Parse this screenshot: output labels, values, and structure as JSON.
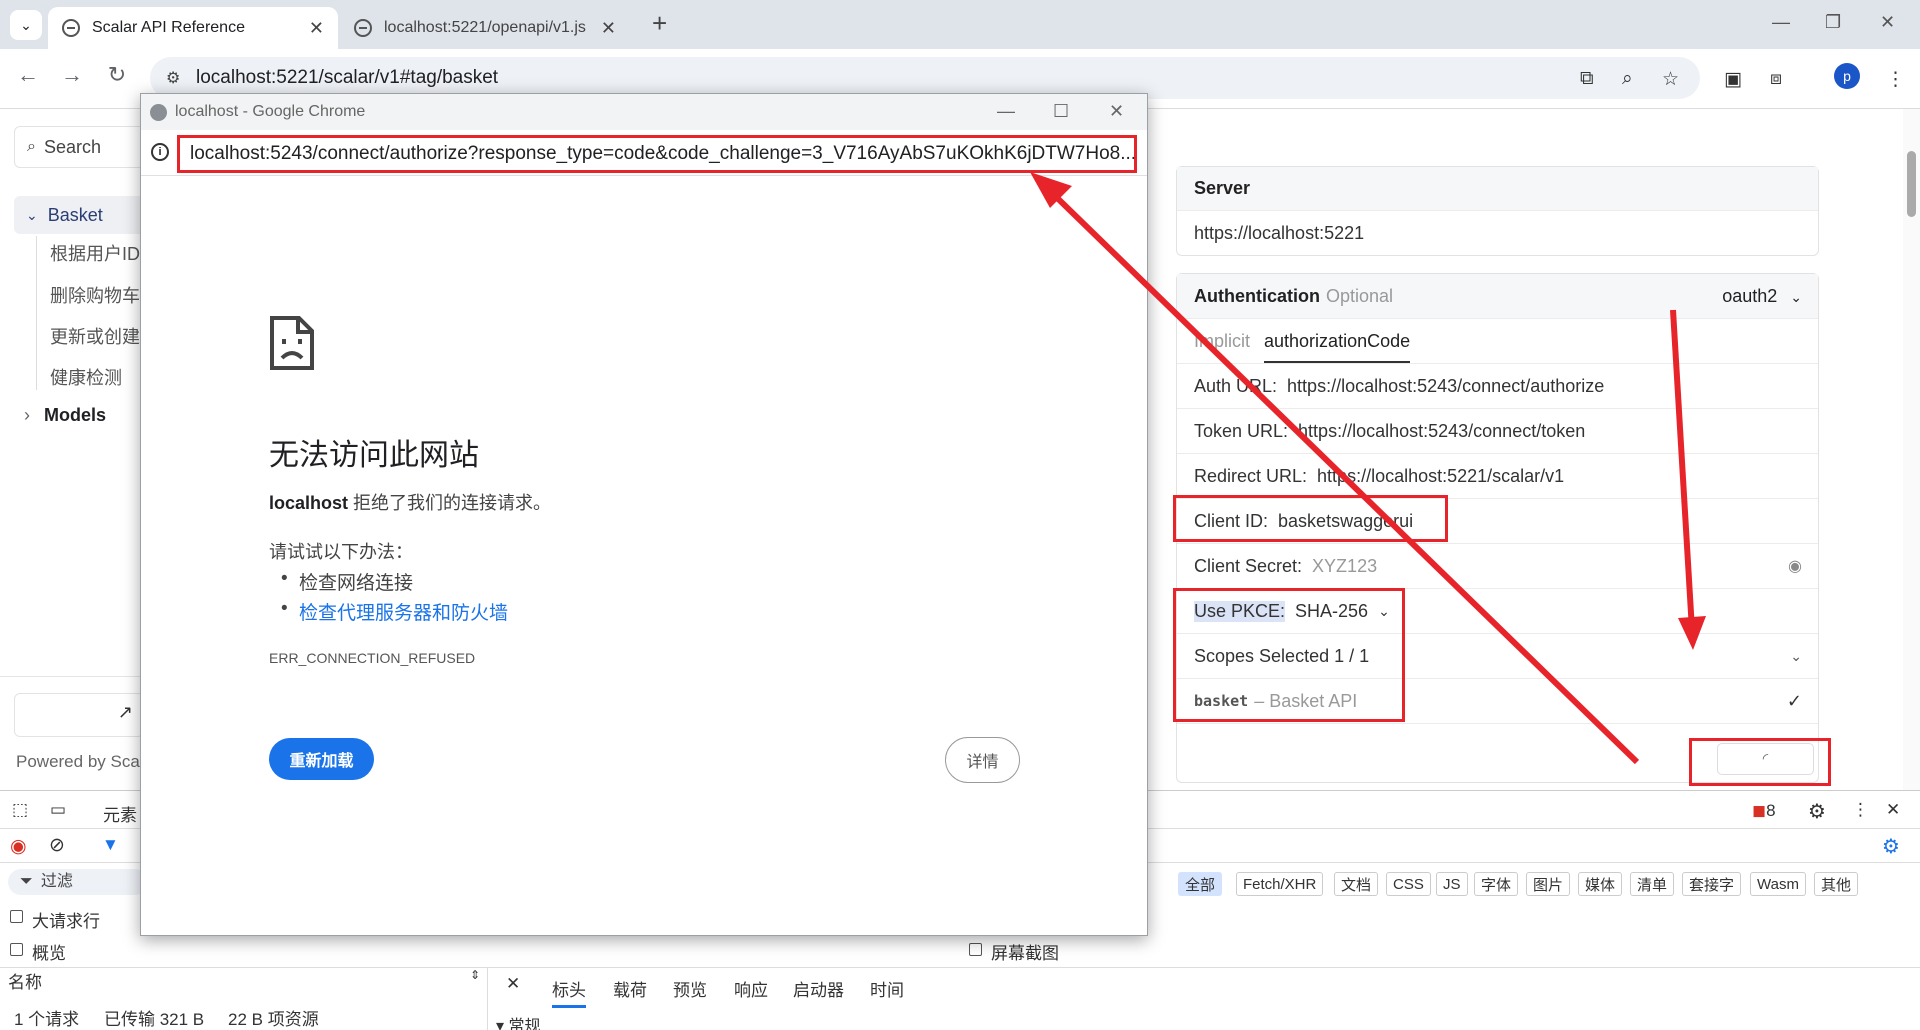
{
  "browser": {
    "tabs": [
      {
        "title": "Scalar API Reference",
        "close": "✕"
      },
      {
        "title": "localhost:5221/openapi/v1.js",
        "close": "✕"
      }
    ],
    "new_tab": "+",
    "address": "localhost:5221/scalar/v1#tag/basket",
    "profile_initial": "p",
    "window_controls": {
      "minimize": "—",
      "maximize": "❐",
      "close": "✕"
    }
  },
  "sidebar": {
    "search_placeholder": "Search",
    "basket_label": "Basket",
    "basket_items": [
      "根据用户ID",
      "删除购物车",
      "更新或创建",
      "健康检测"
    ],
    "models_label": "Models",
    "powered_by": "Powered by Scal"
  },
  "auth_panel": {
    "server_label": "Server",
    "server_url": "https://localhost:5221",
    "auth_label": "Authentication",
    "auth_optional": "Optional",
    "auth_scheme": "oauth2",
    "flow_tabs": [
      "Implicit",
      "authorizationCode"
    ],
    "auth_url_label": "Auth URL:",
    "auth_url": "https://localhost:5243/connect/authorize",
    "token_url_label": "Token URL:",
    "token_url": "https://localhost:5243/connect/token",
    "redirect_url_label": "Redirect URL:",
    "redirect_url": "https://localhost:5221/scalar/v1",
    "client_id_label": "Client ID:",
    "client_id": "basketswaggerui",
    "client_secret_label": "Client Secret:",
    "client_secret_placeholder": "XYZ123",
    "pkce_label": "Use PKCE:",
    "pkce_value": "SHA-256",
    "scopes_label": "Scopes Selected 1 / 1",
    "scope_name": "basket",
    "scope_desc": "– Basket API"
  },
  "popup": {
    "window_title": "localhost - Google Chrome",
    "url": "localhost:5243/connect/authorize?response_type=code&code_challenge=3_V716AyAbS7uKOkhK6jDTW7Ho8...",
    "error_title": "无法访问此网站",
    "error_host": "localhost",
    "error_desc": " 拒绝了我们的连接请求。",
    "try_label": "请试试以下办法：",
    "suggestions": [
      "检查网络连接",
      "检查代理服务器和防火墙"
    ],
    "error_code": "ERR_CONNECTION_REFUSED",
    "reload_label": "重新加载",
    "details_label": "详情"
  },
  "devtools": {
    "elements_tab": "元素",
    "filter_label": "过滤",
    "error_count": "8",
    "filter_chips": [
      "全部",
      "Fetch/XHR",
      "文档",
      "CSS",
      "JS",
      "字体",
      "图片",
      "媒体",
      "清单",
      "套接字",
      "Wasm",
      "其他"
    ],
    "big_rows_label": "大请求行",
    "overview_label": "概览",
    "screenshot_label": "屏幕截图",
    "name_col": "名称",
    "detail_tabs": [
      "标头",
      "载荷",
      "预览",
      "响应",
      "启动器",
      "时间"
    ],
    "general_section": "常规",
    "status": [
      "1 个请求",
      "已传输 321 B",
      "22 B 项资源"
    ]
  },
  "colors": {
    "annotation": "#e8242b",
    "link": "#1a73e8",
    "accent": "#1a56c7"
  }
}
